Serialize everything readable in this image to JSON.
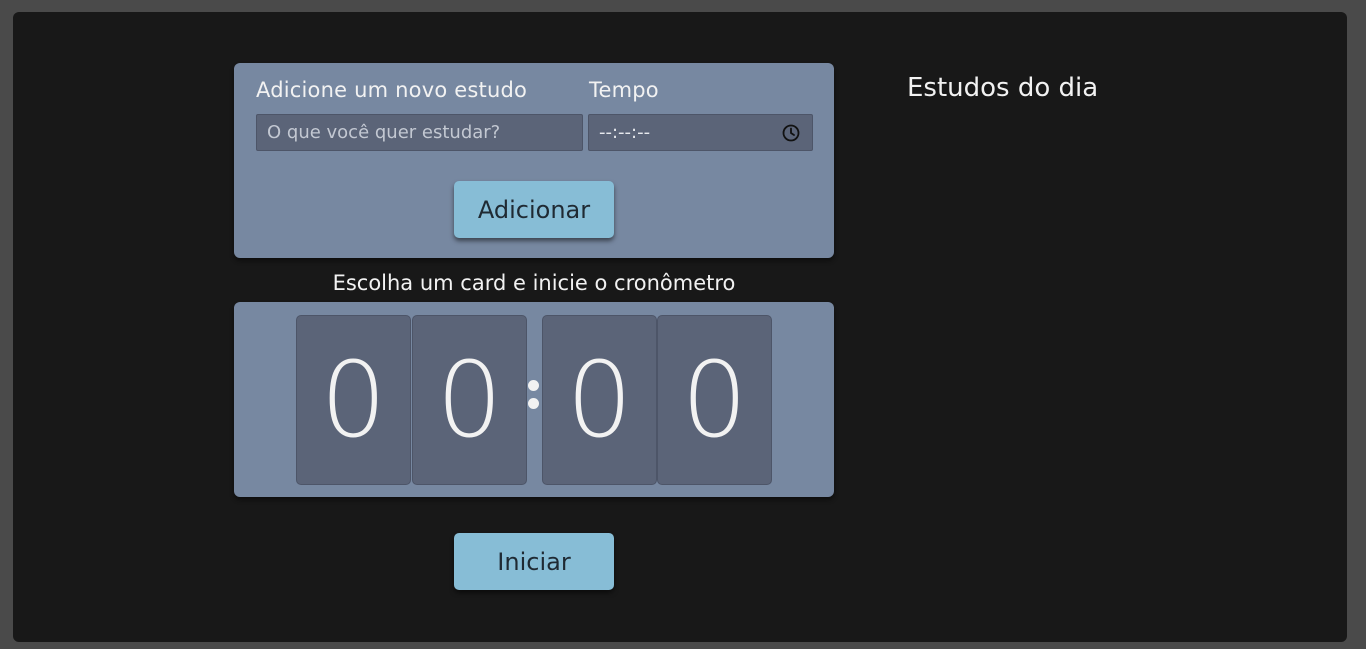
{
  "form": {
    "subject_label": "Adicione um novo estudo",
    "time_label": "Tempo",
    "subject_placeholder": "O que você quer estudar?",
    "time_value": "--:--:--",
    "time_icon": "clock-icon",
    "add_button": "Adicionar"
  },
  "timer": {
    "title": "Escolha um card e inicie o cronômetro",
    "digits": [
      "0",
      "0",
      "0",
      "0"
    ],
    "start_button": "Iniciar"
  },
  "daily": {
    "title": "Estudos do dia"
  },
  "colors": {
    "page_background": "#181818",
    "card_background": "#7788a1",
    "field_background": "#5b6478",
    "button_background": "#87bdd6",
    "text": "#f2f2f2"
  }
}
